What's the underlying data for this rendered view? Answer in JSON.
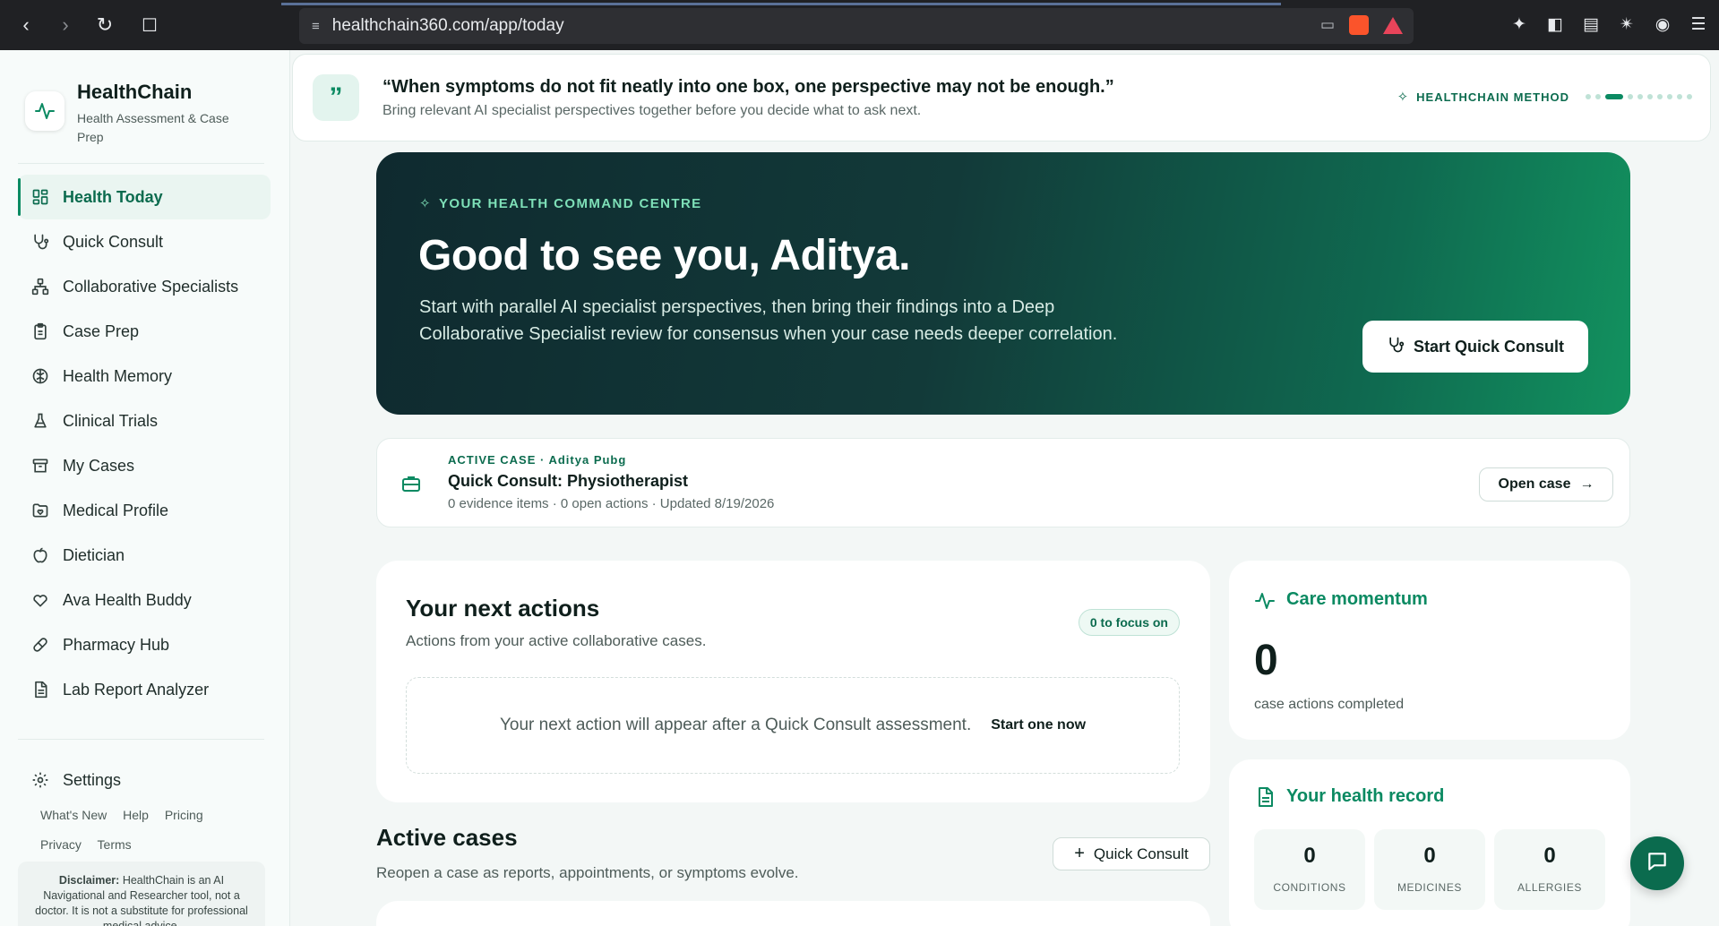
{
  "browser": {
    "url": "healthchain360.com/app/today"
  },
  "brand": {
    "title": "HealthChain",
    "subtitle": "Health Assessment & Case Prep"
  },
  "sidebar": {
    "items": [
      {
        "label": "Health Today",
        "icon": "grid-icon",
        "active": true
      },
      {
        "label": "Quick Consult",
        "icon": "stethoscope-icon"
      },
      {
        "label": "Collaborative Specialists",
        "icon": "network-icon"
      },
      {
        "label": "Case Prep",
        "icon": "clipboard-icon"
      },
      {
        "label": "Health Memory",
        "icon": "brain-icon"
      },
      {
        "label": "Clinical Trials",
        "icon": "flask-icon"
      },
      {
        "label": "My Cases",
        "icon": "archive-icon"
      },
      {
        "label": "Medical Profile",
        "icon": "folder-heart-icon"
      },
      {
        "label": "Dietician",
        "icon": "apple-icon"
      },
      {
        "label": "Ava Health Buddy",
        "icon": "heart-icon"
      },
      {
        "label": "Pharmacy Hub",
        "icon": "pill-icon"
      },
      {
        "label": "Lab Report Analyzer",
        "icon": "file-text-icon"
      }
    ],
    "settings": "Settings",
    "links": [
      "What's New",
      "Help",
      "Pricing",
      "Privacy",
      "Terms"
    ],
    "disclaimer_label": "Disclaimer:",
    "disclaimer_text": "HealthChain is an AI Navigational and Researcher tool, not a doctor. It is not a substitute for professional medical advice."
  },
  "quote": {
    "text": "“When symptoms do not fit neatly into one box, one perspective may not be enough.”",
    "sub": "Bring relevant AI specialist perspectives together before you decide what to ask next.",
    "method": "HEALTHCHAIN METHOD",
    "active_dot": 2,
    "dot_count": 10
  },
  "hero": {
    "eyebrow": "YOUR HEALTH COMMAND CENTRE",
    "title": "Good to see you, Aditya.",
    "description": "Start with parallel AI specialist perspectives, then bring their findings into a Deep Collaborative Specialist review for consensus when your case needs deeper correlation.",
    "button": "Start Quick Consult"
  },
  "active_case": {
    "tag": "ACTIVE CASE · Aditya Pubg",
    "title": "Quick Consult: Physiotherapist",
    "meta": "0 evidence items · 0 open actions · Updated 8/19/2026",
    "button": "Open case"
  },
  "next_actions": {
    "title": "Your next actions",
    "subtitle": "Actions from your active collaborative cases.",
    "badge": "0 to focus on",
    "empty": "Your next action will appear after a Quick Consult assessment.",
    "cta": "Start one now"
  },
  "momentum": {
    "title": "Care momentum",
    "value": "0",
    "label": "case actions completed"
  },
  "health_record": {
    "title": "Your health record",
    "stats": [
      {
        "value": "0",
        "label": "CONDITIONS"
      },
      {
        "value": "0",
        "label": "MEDICINES"
      },
      {
        "value": "0",
        "label": "ALLERGIES"
      }
    ]
  },
  "active_cases": {
    "title": "Active cases",
    "subtitle": "Reopen a case as reports, appointments, or symptoms evolve.",
    "button": "Quick Consult"
  },
  "colors": {
    "accent": "#0b8a62",
    "accent_dark": "#0b6b4e"
  }
}
